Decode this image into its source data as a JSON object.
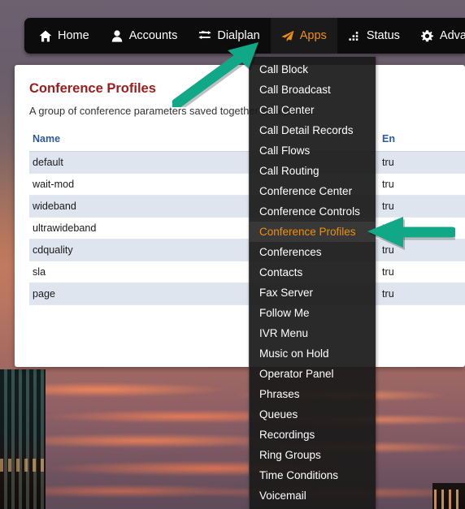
{
  "navbar": {
    "items": [
      {
        "label": "Home",
        "icon": "home-icon",
        "active": false
      },
      {
        "label": "Accounts",
        "icon": "user-icon",
        "active": false
      },
      {
        "label": "Dialplan",
        "icon": "transfer-icon",
        "active": false
      },
      {
        "label": "Apps",
        "icon": "paper-plane-icon",
        "active": true
      },
      {
        "label": "Status",
        "icon": "bar-dots-icon",
        "active": false
      },
      {
        "label": "Advanced",
        "icon": "gear-icon",
        "active": false
      }
    ],
    "active_color": "#f0900a",
    "background": "#0c0c0c"
  },
  "apps_menu": {
    "highlighted": "Conference Profiles",
    "highlight_color": "#f0900a",
    "items": [
      "Call Block",
      "Call Broadcast",
      "Call Center",
      "Call Detail Records",
      "Call Flows",
      "Call Routing",
      "Conference Center",
      "Conference Controls",
      "Conference Profiles",
      "Conferences",
      "Contacts",
      "Fax Server",
      "Follow Me",
      "IVR Menu",
      "Music on Hold",
      "Operator Panel",
      "Phrases",
      "Queues",
      "Recordings",
      "Ring Groups",
      "Time Conditions",
      "Voicemail"
    ]
  },
  "content": {
    "title": "Conference Profiles",
    "title_color": "#9c1c1c",
    "subtitle": "A group of conference parameters saved together as a profile.",
    "table": {
      "headers": [
        "Name",
        "En"
      ],
      "header_color": "#2c5aa0",
      "rows": [
        {
          "name": "default",
          "enabled": "tru"
        },
        {
          "name": "wait-mod",
          "enabled": "tru"
        },
        {
          "name": "wideband",
          "enabled": "tru"
        },
        {
          "name": "ultrawideband",
          "enabled": "tru"
        },
        {
          "name": "cdquality",
          "enabled": "tru"
        },
        {
          "name": "sla",
          "enabled": "tru"
        },
        {
          "name": "page",
          "enabled": "tru"
        }
      ]
    }
  },
  "annotations": {
    "arrow_color": "#11a887",
    "arrow_to_apps": "points up-right to Apps nav item",
    "arrow_to_profiles": "points left to Conference Profiles menu item"
  }
}
